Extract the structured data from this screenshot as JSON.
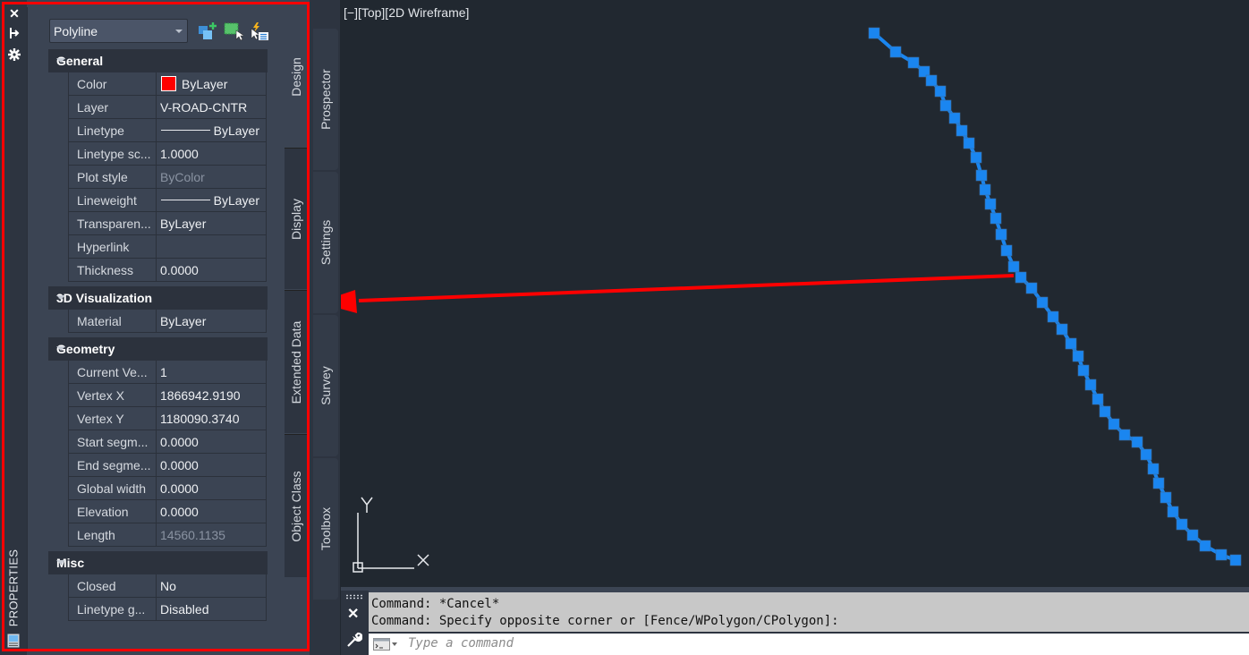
{
  "palette": {
    "title": "PROPERTIES",
    "strip_icons": [
      "close-icon",
      "auto-hide-icon",
      "settings-icon"
    ],
    "object_type": "Polyline",
    "toolbar_icons": [
      "toggle-pickadd-icon",
      "select-objects-icon",
      "quick-select-icon"
    ],
    "sections": [
      {
        "title": "General",
        "rows": [
          {
            "name": "Color",
            "value": "ByLayer",
            "swatch": "#ff0000"
          },
          {
            "name": "Layer",
            "value": "V-ROAD-CNTR"
          },
          {
            "name": "Linetype",
            "value": "ByLayer",
            "line": true
          },
          {
            "name": "Linetype sc...",
            "value": "1.0000"
          },
          {
            "name": "Plot style",
            "value": "ByColor",
            "dim": true
          },
          {
            "name": "Lineweight",
            "value": "ByLayer",
            "line": true
          },
          {
            "name": "Transparen...",
            "value": "ByLayer"
          },
          {
            "name": "Hyperlink",
            "value": ""
          },
          {
            "name": "Thickness",
            "value": "0.0000"
          }
        ]
      },
      {
        "title": "3D Visualization",
        "rows": [
          {
            "name": "Material",
            "value": "ByLayer"
          }
        ]
      },
      {
        "title": "Geometry",
        "rows": [
          {
            "name": "Current Ve...",
            "value": "1"
          },
          {
            "name": "Vertex X",
            "value": "1866942.9190"
          },
          {
            "name": "Vertex Y",
            "value": "1180090.3740"
          },
          {
            "name": "Start segm...",
            "value": "0.0000"
          },
          {
            "name": "End segme...",
            "value": "0.0000"
          },
          {
            "name": "Global width",
            "value": "0.0000"
          },
          {
            "name": "Elevation",
            "value": "0.0000"
          },
          {
            "name": "Length",
            "value": "14560.1135",
            "dim": true
          }
        ]
      },
      {
        "title": "Misc",
        "rows": [
          {
            "name": "Closed",
            "value": "No"
          },
          {
            "name": "Linetype g...",
            "value": "Disabled"
          }
        ]
      }
    ],
    "side_tabs": [
      "Design",
      "Display",
      "Extended Data",
      "Object Class"
    ]
  },
  "toolspace_tabs": [
    "Prospector",
    "Settings",
    "Survey",
    "Toolbox"
  ],
  "viewport": {
    "label": "[−][Top][2D Wireframe]",
    "ucs_x": "X",
    "ucs_y": "Y",
    "polyline_color": "#1a86f0"
  },
  "command": {
    "history": [
      "Command: *Cancel*",
      "Command: Specify opposite corner or [Fence/WPolygon/CPolygon]:"
    ],
    "placeholder": "Type a command"
  },
  "annotation": {
    "color": "#ff0000"
  }
}
